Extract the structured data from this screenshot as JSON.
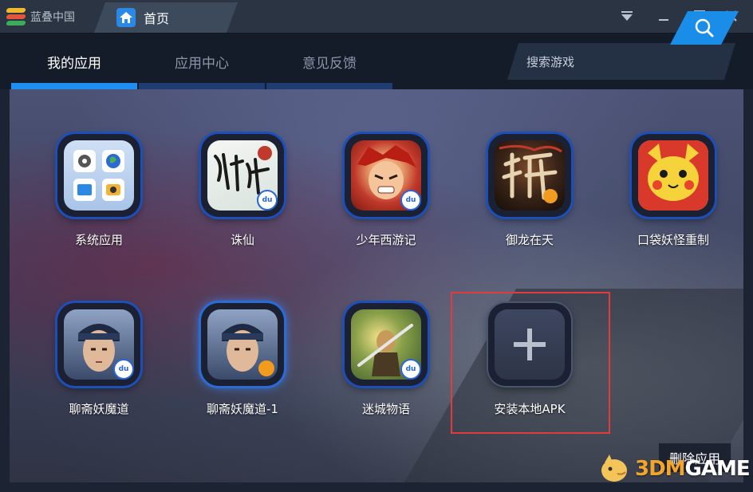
{
  "titlebar": {
    "app_name": "蓝叠中国",
    "tab_title": "首页",
    "controls": [
      "menu-icon",
      "minimize-icon",
      "maximize-icon",
      "close-icon"
    ]
  },
  "nav": {
    "tabs": [
      {
        "label": "我的应用",
        "active": true
      },
      {
        "label": "应用中心",
        "active": false
      },
      {
        "label": "意见反馈",
        "active": false
      }
    ],
    "search_placeholder": "搜索游戏"
  },
  "apps": [
    {
      "label": "系统应用",
      "icon": "system-apps-icon"
    },
    {
      "label": "诛仙",
      "icon": "zhuxian-game-icon",
      "badge": "du"
    },
    {
      "label": "少年西游记",
      "icon": "shaonian-xiyouji-game-icon",
      "badge": "du"
    },
    {
      "label": "御龙在天",
      "icon": "yulong-zaitian-game-icon"
    },
    {
      "label": "口袋妖怪重制",
      "icon": "pocket-monster-game-icon"
    },
    {
      "label": "聊斋妖魔道",
      "icon": "liaozhai-game-icon",
      "badge": "du"
    },
    {
      "label": "聊斋妖魔道-1",
      "icon": "liaozhai-game-icon"
    },
    {
      "label": "迷城物语",
      "icon": "micheng-wuyu-game-icon",
      "badge": "du"
    },
    {
      "label": "安装本地APK",
      "icon": "plus-icon"
    }
  ],
  "delete_button": "删除应用",
  "watermark": {
    "prefix": "3DM",
    "suffix": "GAME"
  },
  "colors": {
    "accent": "#1e8ef0",
    "highlight": "#e03c3c",
    "titlebar": "#2a3442"
  }
}
